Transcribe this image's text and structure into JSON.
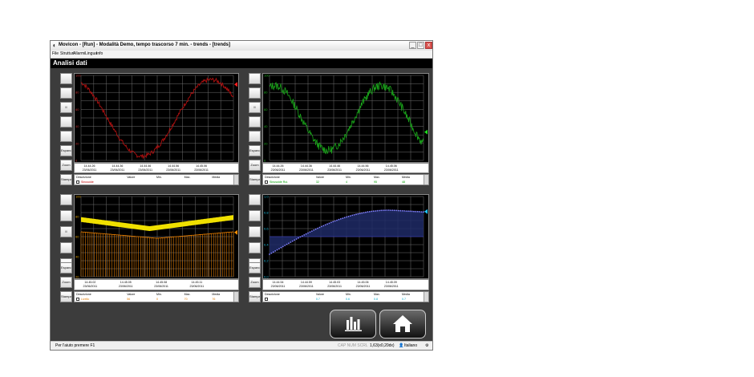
{
  "window": {
    "title": "Movicon - [Run] - Modalità Demo, tempo trascorso 7 min. - trends - [trends]",
    "controls": [
      "_",
      "□",
      "x"
    ]
  },
  "menu": [
    "File",
    "Strutturi",
    "Allarmi",
    "Lingua",
    "Info"
  ],
  "header": {
    "title": "Analisi dati"
  },
  "panels": [
    {
      "buttons": [
        "",
        "",
        "II",
        "",
        "",
        "Espandi",
        "Zoom",
        "Stampa"
      ],
      "yticks": [
        "100",
        "80",
        "60",
        "40",
        "20",
        "0"
      ],
      "times": [
        {
          "t": "14.44.26",
          "d": "23/06/2011"
        },
        {
          "t": "14.44.36",
          "d": "23/06/2011"
        },
        {
          "t": "14.44.46",
          "d": "23/06/2011"
        },
        {
          "t": "14.44.56",
          "d": "23/06/2011"
        },
        {
          "t": "14.45.06",
          "d": "23/06/2011"
        }
      ],
      "legend_headers": [
        "Descrizione",
        "Valore",
        "Min.",
        "Max.",
        "Media"
      ],
      "legend_values": [
        "Sinusoide",
        "",
        "",
        "",
        ""
      ],
      "legend_color": "#c00000"
    },
    {
      "buttons": [
        "",
        "",
        "II",
        "",
        "",
        "Espandi",
        "Zoom",
        "Stampa"
      ],
      "yticks": [
        "100",
        "80",
        "60",
        "40",
        "20",
        "0"
      ],
      "times": [
        {
          "t": "14.44.26",
          "d": "23/06/2011"
        },
        {
          "t": "14.44.36",
          "d": "23/06/2011"
        },
        {
          "t": "14.44.46",
          "d": "23/06/2011"
        },
        {
          "t": "14.44.56",
          "d": "23/06/2011"
        },
        {
          "t": "14.45.06",
          "d": "23/06/2011"
        }
      ],
      "legend_headers": [
        "Descrizione",
        "Valore",
        "Min.",
        "Max.",
        "Media"
      ],
      "legend_values": [
        "Sinusoide Rui.",
        "32",
        "4",
        "95",
        "48"
      ],
      "legend_color": "#00a000"
    },
    {
      "buttons": [
        "",
        "",
        "II",
        "",
        "",
        "Espandi",
        "Zoom",
        "Stampa"
      ],
      "yticks": [
        "100",
        "80",
        "60",
        "40",
        "20"
      ],
      "times": [
        {
          "t": "14.45.02",
          "d": "23/06/2011"
        },
        {
          "t": "14.45.05",
          "d": "23/06/2011"
        },
        {
          "t": "14.45.08",
          "d": "23/06/2011"
        },
        {
          "t": "14.45.11",
          "d": "23/06/2011"
        }
      ],
      "legend_headers": [
        "Descrizione",
        "Valore",
        "Min.",
        "Max.",
        "Media"
      ],
      "legend_values": [
        "Livello",
        "56",
        "0",
        "70",
        "76"
      ],
      "legend_color": "#e07a00"
    },
    {
      "buttons": [
        "",
        "",
        "",
        "",
        "",
        "Espandi",
        "Zoom",
        "Stampa"
      ],
      "yticks": [
        "1.0",
        "0.8",
        "0.6",
        "0.4",
        "0.2",
        "0.0"
      ],
      "times": [
        {
          "t": "14.44.54",
          "d": "23/06/2011"
        },
        {
          "t": "14.44.59",
          "d": "23/06/2011"
        },
        {
          "t": "14.45.03",
          "d": "23/06/2011"
        },
        {
          "t": "14.45.06",
          "d": "23/06/2011"
        },
        {
          "t": "14.45.09",
          "d": "23/06/2011"
        }
      ],
      "legend_headers": [
        "Descrizione",
        "Valore",
        "Min.",
        "Max.",
        "Media"
      ],
      "legend_values": [
        "",
        "0.7",
        "0.6",
        "0.8",
        "0.7"
      ],
      "legend_color": "#00a8c8"
    }
  ],
  "status": {
    "help": "Per l'aiuto premere F1",
    "caps": "CAP NUM SCRL",
    "info": "1,63(x0,20dx)",
    "language": "Italiano"
  },
  "colors": {
    "trace1": "#b01010",
    "trace2": "#1aa61a",
    "trace3_top": "#f0e000",
    "trace3_bottom": "#e07a00",
    "trace4": "#8080ff",
    "grid": "#6e6e6e"
  },
  "icons": {
    "chart_button": "bar-chart-icon",
    "home_button": "home-icon"
  }
}
